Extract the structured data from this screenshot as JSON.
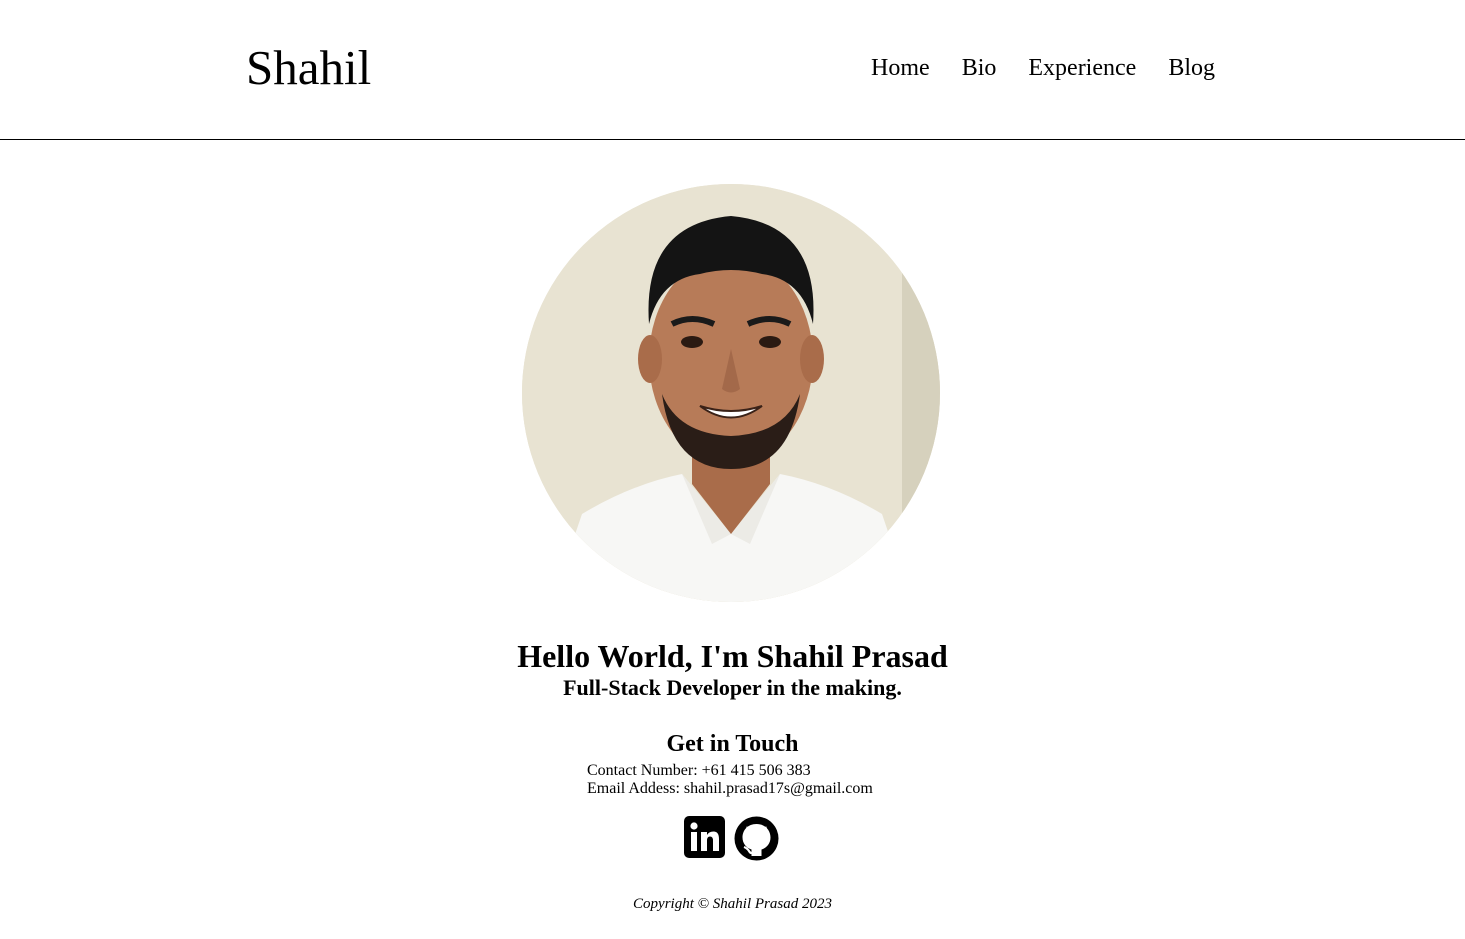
{
  "header": {
    "brand": "Shahil",
    "nav": [
      {
        "label": "Home"
      },
      {
        "label": "Bio"
      },
      {
        "label": "Experience"
      },
      {
        "label": "Blog"
      }
    ]
  },
  "hero": {
    "headline": "Hello World, I'm Shahil Prasad",
    "tagline": "Full-Stack Developer in the making."
  },
  "contact": {
    "title": "Get in Touch",
    "phone_line": "Contact Number: +61 415 506 383",
    "email_line": "Email Addess: shahil.prasad17s@gmail.com"
  },
  "socials": [
    {
      "icon": "linkedin-icon"
    },
    {
      "icon": "github-icon"
    }
  ],
  "footer": {
    "copyright": "Copyright © Shahil Prasad 2023"
  },
  "colors": {
    "text": "#000000",
    "background": "#ffffff",
    "photo_wall": "#e8e3d2",
    "shirt": "#f7f7f5",
    "skin": "#b77b58"
  }
}
